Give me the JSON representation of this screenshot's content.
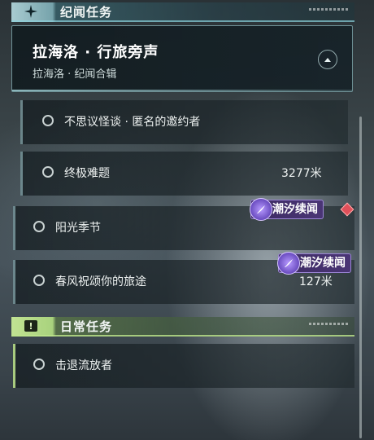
{
  "story_section": {
    "title": "纪闻任务",
    "icon": "sparkle-icon"
  },
  "featured_quest": {
    "title": "拉海洛 · 行旅旁声",
    "subtitle": "拉海洛 · 纪闻合辑",
    "toggle_icon": "chevron-up-icon"
  },
  "story_tasks": [
    {
      "label": "不思议怪谈 · 匿名的邀约者",
      "distance": ""
    },
    {
      "label": "终极难题",
      "distance": "3277米"
    },
    {
      "label": "阳光季节",
      "distance": "",
      "badge": "潮汐续闻",
      "tracked": true
    },
    {
      "label": "春风祝颂你的旅途",
      "distance": "127米",
      "badge": "潮汐续闻"
    }
  ],
  "daily_section": {
    "title": "日常任务",
    "icon": "exclamation-icon"
  },
  "daily_tasks": [
    {
      "label": "击退流放者"
    }
  ],
  "colors": {
    "story_accent": "#8fd3dc",
    "daily_accent": "#bfe48a",
    "badge_purple": "#4a3575",
    "tracked_marker": "#e0505a"
  }
}
